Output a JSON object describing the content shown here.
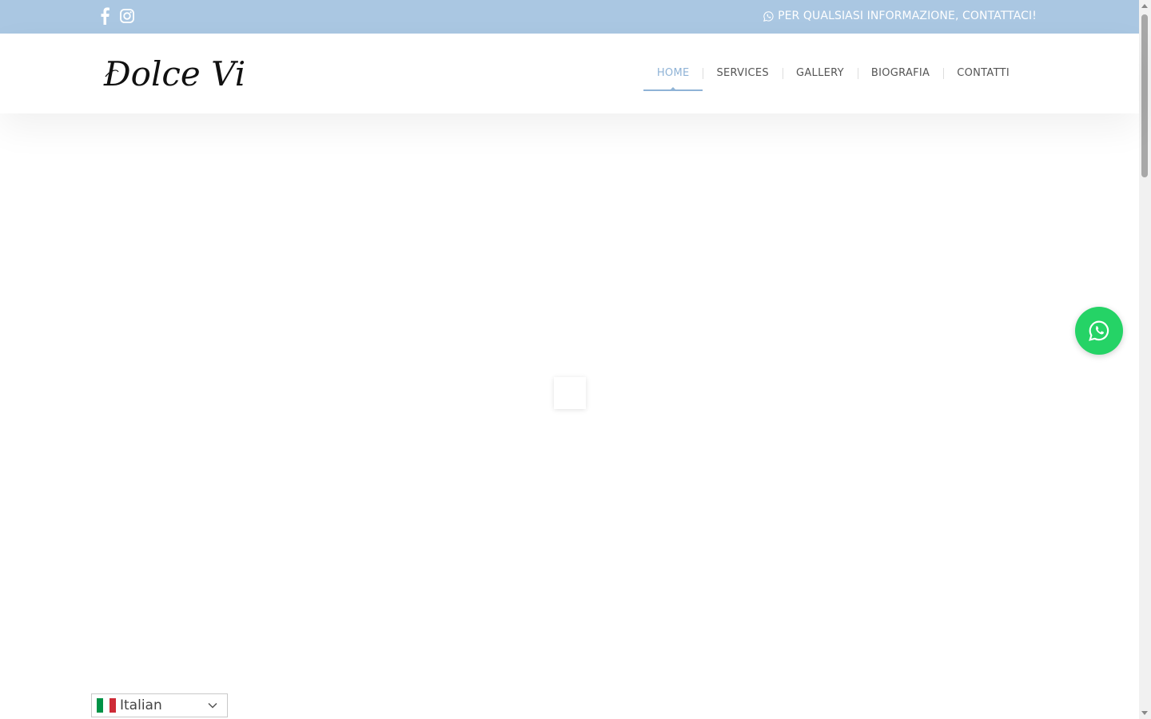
{
  "topbar": {
    "background": "#aac7e2",
    "social": [
      {
        "icon": "facebook-icon"
      },
      {
        "icon": "instagram-icon"
      }
    ],
    "contact_icon": "whatsapp-icon",
    "contact_text": "PER QUALSIASI INFORMAZIONE, CONTATTACI!"
  },
  "header": {
    "logo_text": "Dolce Vita",
    "nav": [
      {
        "label": "HOME",
        "active": true
      },
      {
        "label": "SERVICES",
        "active": false
      },
      {
        "label": "GALLERY",
        "active": false
      },
      {
        "label": "BIOGRAFIA",
        "active": false
      },
      {
        "label": "CONTATTI",
        "active": false
      }
    ],
    "accent": "#8fb3d6"
  },
  "whatsapp_button": {
    "icon": "whatsapp-icon",
    "color": "#25d366"
  },
  "language_selector": {
    "selected": "Italian",
    "flag_colors": [
      "#009246",
      "#ffffff",
      "#ce2b37"
    ]
  }
}
